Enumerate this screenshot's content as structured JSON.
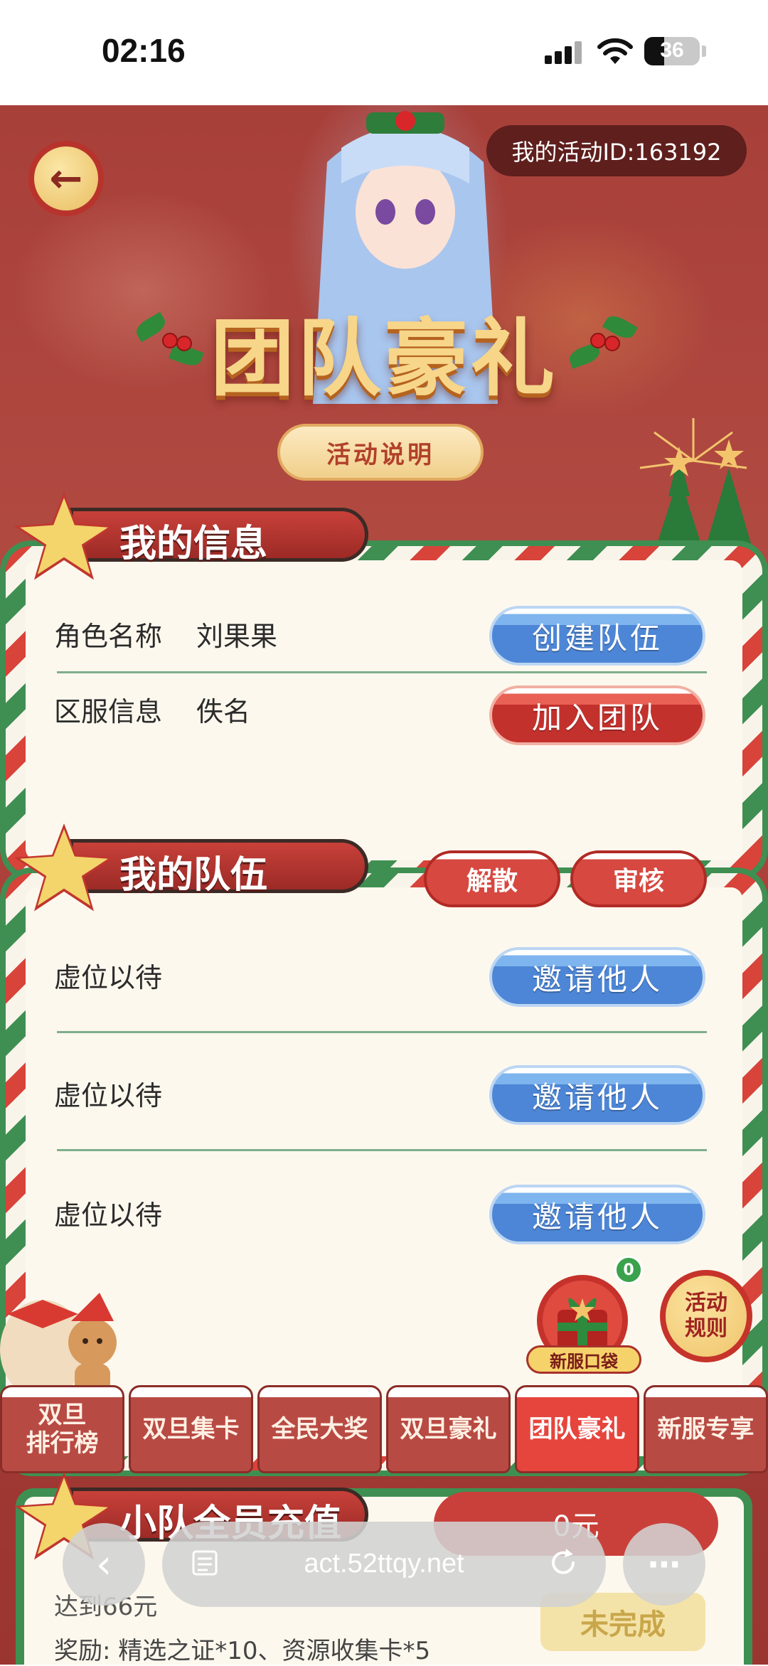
{
  "status_bar": {
    "time": "02:16",
    "battery": "36"
  },
  "header": {
    "activity_id": "我的活动ID:163192",
    "title": "团队豪礼",
    "explain_button": "活动说明"
  },
  "my_info": {
    "title": "我的信息",
    "rows": [
      {
        "label": "角色名称",
        "value": "刘果果"
      },
      {
        "label": "区服信息",
        "value": "佚名"
      }
    ],
    "create_button": "创建队伍",
    "join_button": "加入团队"
  },
  "my_team": {
    "title": "我的队伍",
    "disband_button": "解散",
    "review_button": "审核",
    "slots": [
      {
        "label": "虚位以待",
        "button": "邀请他人"
      },
      {
        "label": "虚位以待",
        "button": "邀请他人"
      },
      {
        "label": "虚位以待",
        "button": "邀请他人"
      }
    ]
  },
  "floating": {
    "gift_badge": "0",
    "gift_label": "新服口袋",
    "rules_line1": "活动",
    "rules_line2": "规则"
  },
  "tabs": [
    {
      "line1": "双旦",
      "line2": "排行榜",
      "active": false
    },
    {
      "line1": "双旦集卡",
      "line2": "",
      "active": false
    },
    {
      "line1": "全民大奖",
      "line2": "",
      "active": false
    },
    {
      "line1": "双旦豪礼",
      "line2": "",
      "active": false
    },
    {
      "line1": "团队豪礼",
      "line2": "",
      "active": true
    },
    {
      "line1": "新服专享",
      "line2": "",
      "active": false
    }
  ],
  "recharge": {
    "title": "小队全员充值",
    "amount": "0元",
    "goal": "达到66元",
    "reward": "奖励: 精选之证*10、资源收集卡*5",
    "status": "未完成"
  },
  "browser": {
    "url": "act.52ttqy.net"
  }
}
